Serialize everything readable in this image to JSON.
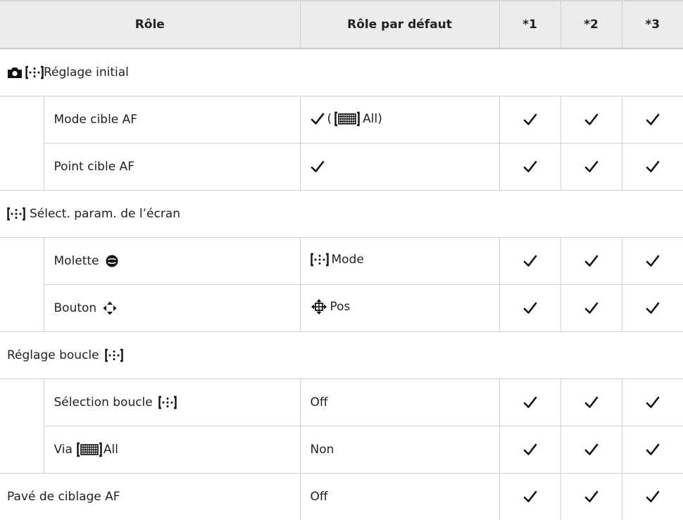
{
  "header": {
    "role": "Rôle",
    "default_role": "Rôle par défaut",
    "col1": "*1",
    "col2": "*2",
    "col3": "*3"
  },
  "sections": [
    {
      "title": "Réglage initial",
      "icons": [
        "camera-icon",
        "af-target-icon"
      ],
      "items": [
        {
          "label": "Mode cible AF",
          "default_prefix": "(",
          "default_text": "All)",
          "default_icons": [
            "checkmark-icon",
            "all-target-icon"
          ]
        },
        {
          "label": "Point cible AF",
          "default_icons": [
            "checkmark-icon"
          ]
        }
      ]
    },
    {
      "title": "Sélect. param. de l’écran",
      "icons": [
        "af-target-icon"
      ],
      "items": [
        {
          "label": "Molette",
          "label_icon": "dial-icon",
          "default_text": "Mode",
          "default_icons": [
            "af-target-icon"
          ]
        },
        {
          "label": "Bouton",
          "label_icon": "arrow-pad-icon",
          "default_text": "Pos",
          "default_icons": [
            "arrow-pad-pos-icon"
          ]
        }
      ]
    },
    {
      "title": "Réglage boucle",
      "icons": [
        "af-target-icon"
      ],
      "items": [
        {
          "label": "Sélection boucle",
          "label_icon": "af-target-icon",
          "default_text": "Off"
        },
        {
          "label": "Via",
          "label_icon": "all-target-icon",
          "label_suffix": "All",
          "default_text": "Non"
        }
      ]
    }
  ],
  "last_row": {
    "label": "Pavé de ciblage AF",
    "default_text": "Off"
  },
  "checks": [
    "checkmark-icon",
    "checkmark-icon",
    "checkmark-icon"
  ]
}
